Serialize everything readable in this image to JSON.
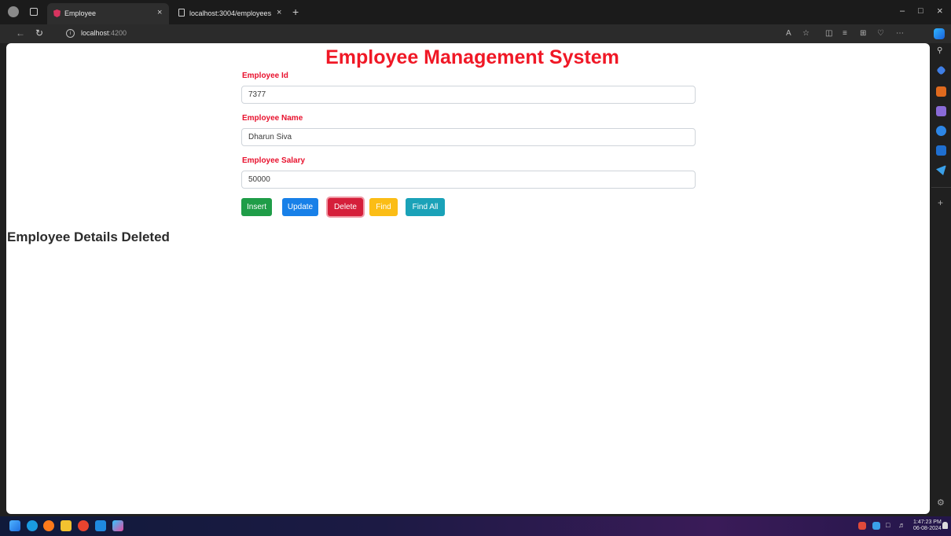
{
  "browser": {
    "tabs": [
      {
        "label": "Employee"
      },
      {
        "label": "localhost:3004/employees"
      }
    ],
    "close_glyph": "×",
    "new_tab_glyph": "+",
    "url_host": "localhost",
    "url_port": ":4200"
  },
  "page": {
    "title": "Employee Management System",
    "fields": [
      {
        "label": "Employee Id",
        "value": "7377"
      },
      {
        "label": "Employee Name",
        "value": "Dharun Siva"
      },
      {
        "label": "Employee Salary",
        "value": "50000"
      }
    ],
    "buttons": {
      "insert": "Insert",
      "update": "Update",
      "delete": "Delete",
      "find": "Find",
      "find_all": "Find All"
    },
    "status_message": "Employee Details Deleted"
  },
  "taskbar": {
    "time": "1:47:23 PM",
    "date": "06-08-2024"
  },
  "colors": {
    "title_red": "#f01826",
    "label_red": "#e8112d",
    "insert": "#1f9d48",
    "update": "#1880e8",
    "delete": "#d51f3a",
    "find": "#fbbd16",
    "find_all": "#1aa2b8"
  }
}
